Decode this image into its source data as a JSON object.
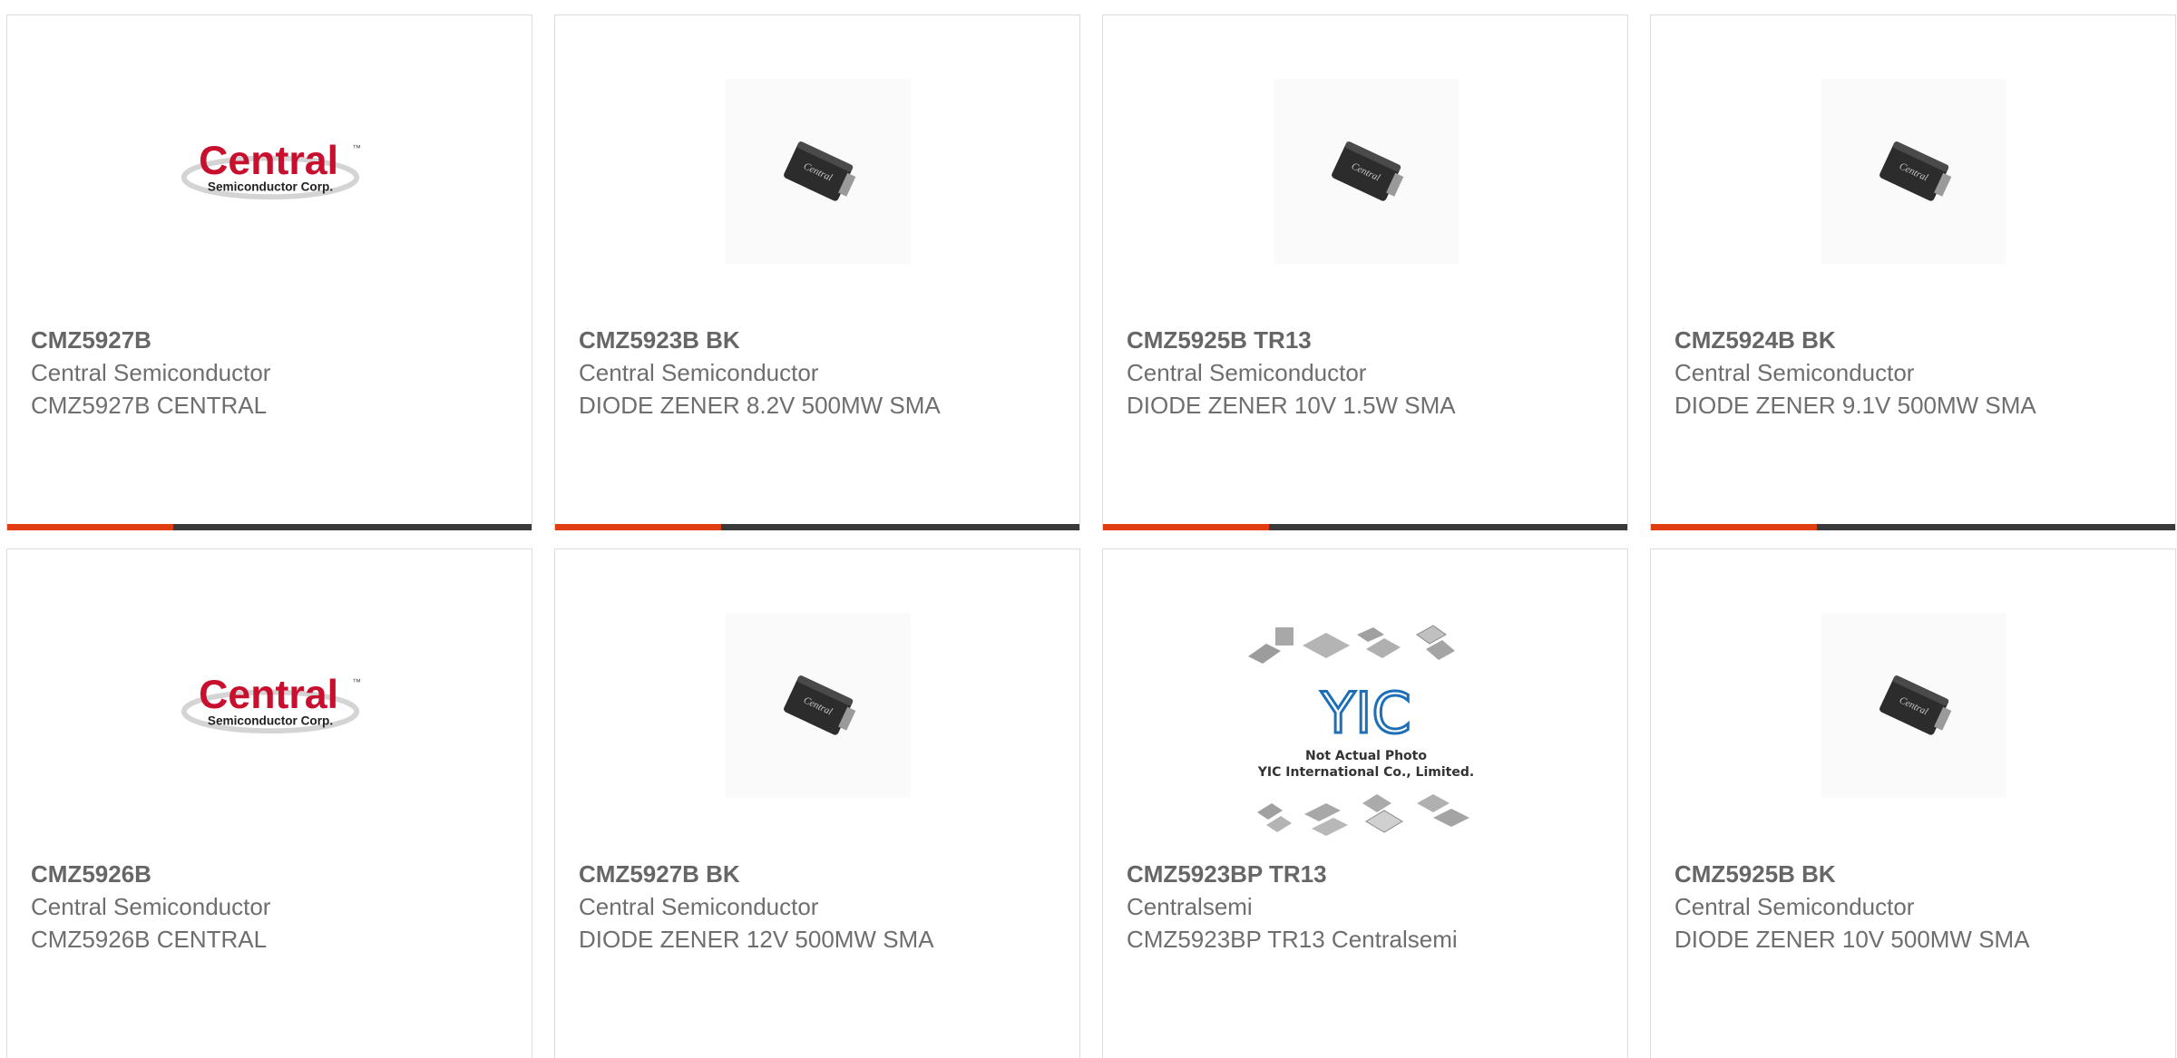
{
  "colors": {
    "accent": "#e23c12",
    "bar_dark": "#3a3a3a",
    "logo_red": "#c8102e",
    "text": "#6e6e6e"
  },
  "logos": {
    "central_word": "Central",
    "central_sub": "Semiconductor Corp.",
    "central_tm": "™",
    "chip_print": "Central",
    "yic_mark": "YIC",
    "yic_line1": "Not Actual Photo",
    "yic_line2": "YIC International Co., Limited."
  },
  "products": [
    {
      "part": "CMZ5927B",
      "manufacturer": "Central Semiconductor",
      "description": "CMZ5927B CENTRAL",
      "image": "central-logo"
    },
    {
      "part": "CMZ5923B BK",
      "manufacturer": "Central Semiconductor",
      "description": "DIODE ZENER 8.2V 500MW SMA",
      "image": "sma-chip"
    },
    {
      "part": "CMZ5925B TR13",
      "manufacturer": "Central Semiconductor",
      "description": "DIODE ZENER 10V 1.5W SMA",
      "image": "sma-chip"
    },
    {
      "part": "CMZ5924B BK",
      "manufacturer": "Central Semiconductor",
      "description": "DIODE ZENER 9.1V 500MW SMA",
      "image": "sma-chip"
    },
    {
      "part": "CMZ5926B",
      "manufacturer": "Central Semiconductor",
      "description": "CMZ5926B CENTRAL",
      "image": "central-logo"
    },
    {
      "part": "CMZ5927B BK",
      "manufacturer": "Central Semiconductor",
      "description": "DIODE ZENER 12V 500MW SMA",
      "image": "sma-chip"
    },
    {
      "part": "CMZ5923BP TR13",
      "manufacturer": "Centralsemi",
      "description": "CMZ5923BP TR13 Centralsemi",
      "image": "yic-placeholder"
    },
    {
      "part": "CMZ5925B BK",
      "manufacturer": "Central Semiconductor",
      "description": "DIODE ZENER 10V 500MW SMA",
      "image": "sma-chip"
    }
  ]
}
